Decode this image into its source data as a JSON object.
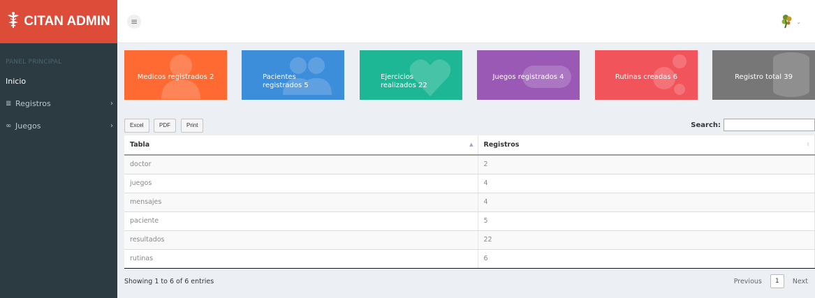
{
  "brand": {
    "title": "CITAN ADMIN",
    "icon": "caduceus-icon"
  },
  "header": {
    "menu_icon": "hamburger-icon",
    "user_icon": "user-avatar-icon"
  },
  "sidebar": {
    "section": "PANEL PRINCIPAL",
    "items": [
      {
        "label": "Inicio",
        "icon": "",
        "active": true
      },
      {
        "label": "Registros",
        "icon": "database-icon",
        "has_submenu": true
      },
      {
        "label": "Juegos",
        "icon": "gamepad-icon",
        "has_submenu": true
      }
    ]
  },
  "stat_boxes": [
    {
      "label": "Medicos registrados 2",
      "color": "#ff6a33",
      "icon": "user-icon"
    },
    {
      "label": "Pacientes registrados 5",
      "color": "#3c8dda",
      "icon": "users-icon"
    },
    {
      "label": "Ejercicios realizados 22",
      "color": "#1eb795",
      "icon": "heart-icon"
    },
    {
      "label": "Juegos registrados 4",
      "color": "#9a59b5",
      "icon": "gamepad-icon"
    },
    {
      "label": "Rutinas creadas 6",
      "color": "#f1545a",
      "icon": "gears-icon"
    },
    {
      "label": "Registro total 39",
      "color": "#777777",
      "icon": "database-icon"
    }
  ],
  "toolbar": {
    "excel": "Excel",
    "pdf": "PDF",
    "print": "Print",
    "search_label": "Search:",
    "search_value": ""
  },
  "table": {
    "columns": [
      "Tabla",
      "Registros"
    ],
    "rows": [
      [
        "doctor",
        "2"
      ],
      [
        "juegos",
        "4"
      ],
      [
        "mensajes",
        "4"
      ],
      [
        "paciente",
        "5"
      ],
      [
        "resultados",
        "22"
      ],
      [
        "rutinas",
        "6"
      ]
    ]
  },
  "footer": {
    "info": "Showing 1 to 6 of 6 entries",
    "previous": "Previous",
    "page": "1",
    "next": "Next"
  }
}
